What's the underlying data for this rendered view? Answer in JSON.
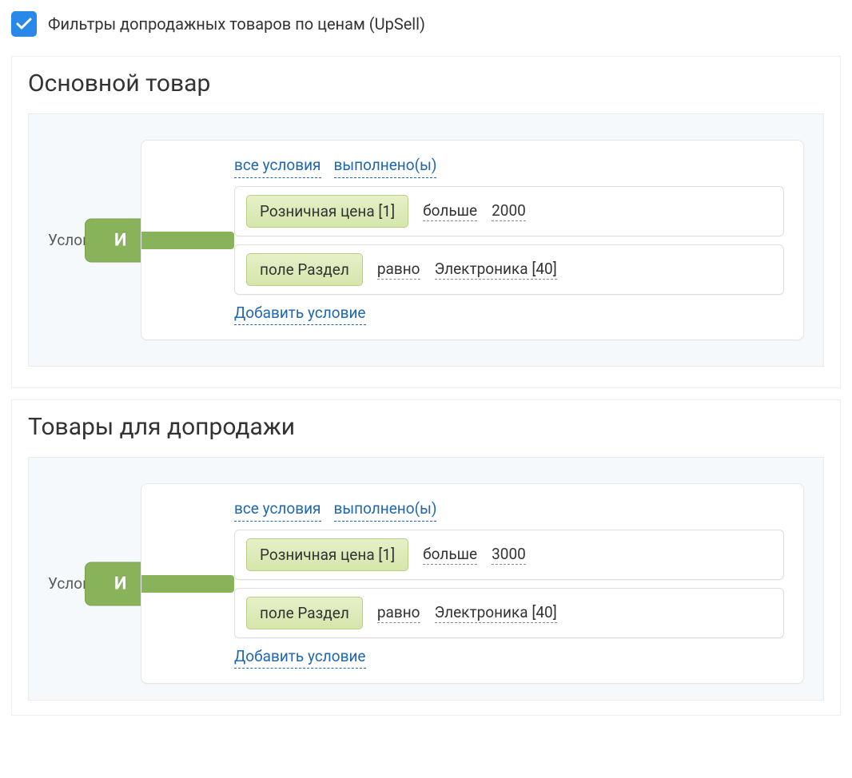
{
  "toggle": {
    "label": "Фильтры допродажных товаров по ценам (UpSell)",
    "checked": true
  },
  "logic_label": "И",
  "header_links": {
    "all_conditions": "все условия",
    "satisfied": "выполнено(ы)"
  },
  "add_condition": "Добавить условие",
  "sections": [
    {
      "title": "Основной товар",
      "side_label": "Условие:",
      "rows": [
        {
          "field": "Розничная цена [1]",
          "op": "больше",
          "value": "2000"
        },
        {
          "field": "поле Раздел",
          "op": "равно",
          "value": "Электроника [40]"
        }
      ]
    },
    {
      "title": "Товары для допродажи",
      "side_label": "Условие:",
      "rows": [
        {
          "field": "Розничная цена [1]",
          "op": "больше",
          "value": "3000"
        },
        {
          "field": "поле Раздел",
          "op": "равно",
          "value": "Электроника [40]"
        }
      ]
    }
  ]
}
